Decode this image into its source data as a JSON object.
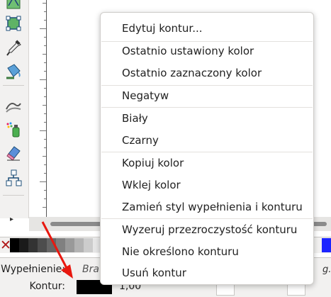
{
  "toolbox": {
    "tools": [
      {
        "icon": "node-tool-icon"
      },
      {
        "icon": "bezier-tool-icon"
      },
      {
        "icon": "dropper-tool-icon"
      },
      {
        "icon": "paint-bucket-icon"
      },
      {
        "icon": "tweak-tool-icon"
      },
      {
        "icon": "spray-tool-icon"
      },
      {
        "icon": "eraser-tool-icon"
      },
      {
        "icon": "connector-tool-icon"
      }
    ],
    "expander": "▸"
  },
  "context_menu": {
    "items": [
      {
        "label": "Edytuj kontur..."
      },
      {
        "label": "Ostatnio ustawiony kolor"
      },
      {
        "label": "Ostatnio zaznaczony kolor"
      },
      {
        "label": "Negatyw"
      },
      {
        "label": "Biały"
      },
      {
        "label": "Czarny"
      },
      {
        "label": "Kopiuj kolor"
      },
      {
        "label": "Wklej kolor"
      },
      {
        "label": "Zamień styl wypełnienia i konturu"
      },
      {
        "label": "Wyzeruj przezroczystość konturu"
      },
      {
        "label": "Nie określono konturu"
      },
      {
        "label": "Usuń kontur"
      }
    ]
  },
  "palette": {
    "none_symbol": "✕",
    "swatch_colors": [
      "#000000",
      "#1a1a1a",
      "#333333",
      "#4d4d4d",
      "#666666",
      "#808080",
      "#999999",
      "#b3b3b3",
      "#cccccc",
      "#e6e6e6",
      "#ffffff"
    ],
    "right_color": "#1c24ff"
  },
  "statusbar": {
    "fill_label": "Wypełnienie:",
    "fill_value": "Bra",
    "stroke_label": "Kontur:",
    "stroke_color": "#000000",
    "stroke_width": "1,00",
    "right_tag": "g."
  },
  "annotation": {
    "arrow_color": "#e8180f",
    "target": "stroke-swatch"
  }
}
